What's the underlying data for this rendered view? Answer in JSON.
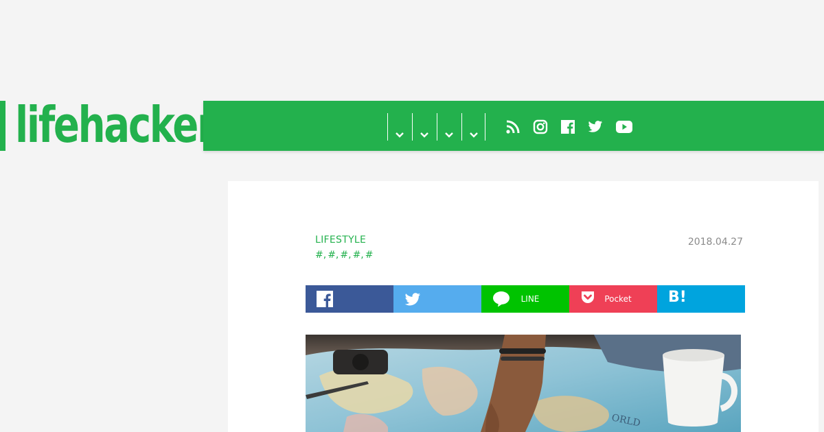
{
  "header": {
    "logo_text": "lifehacker",
    "brand_color": "#23b14d",
    "nav_dropdowns": [
      "chevron-down-icon",
      "chevron-down-icon",
      "chevron-down-icon",
      "chevron-down-icon"
    ],
    "social_icons": [
      "rss-icon",
      "instagram-icon",
      "facebook-icon",
      "twitter-icon",
      "youtube-icon"
    ]
  },
  "article": {
    "category": "LIFESTYLE",
    "tags": [
      "#",
      "#",
      "#",
      "#",
      "#"
    ],
    "date": "2018.04.27",
    "share": {
      "facebook": {
        "icon": "facebook-icon",
        "color": "#3b5998"
      },
      "twitter": {
        "icon": "twitter-icon",
        "color": "#55acee"
      },
      "line": {
        "icon": "line-icon",
        "label": "LINE",
        "color": "#00c300"
      },
      "pocket": {
        "icon": "pocket-icon",
        "label": "Pocket",
        "color": "#ef4056"
      },
      "hatena": {
        "label": "B!",
        "color": "#00a4de"
      }
    },
    "hero_image": "photo of hands on a world map with a coffee cup"
  }
}
